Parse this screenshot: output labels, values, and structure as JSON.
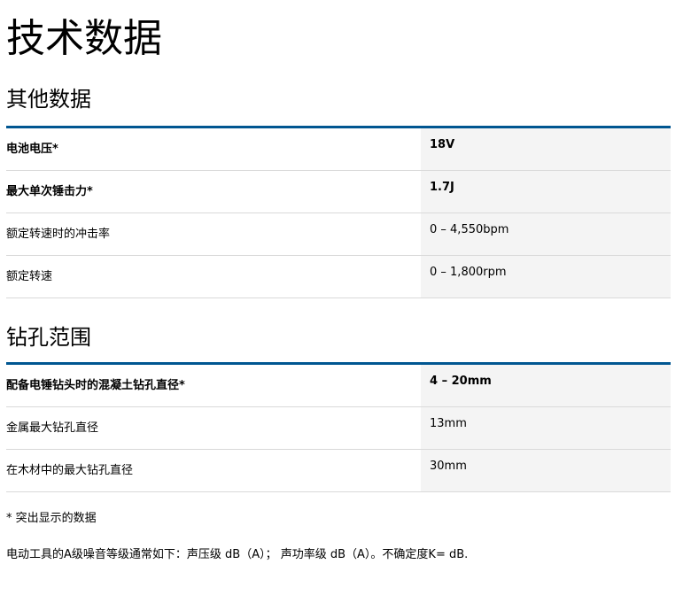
{
  "page_title": "技术数据",
  "sections": [
    {
      "title": "其他数据",
      "rows": [
        {
          "label": "电池电压*",
          "value": "18V",
          "highlight": true
        },
        {
          "label": "最大单次锤击力*",
          "value": "1.7J",
          "highlight": true
        },
        {
          "label": "额定转速时的冲击率",
          "value": "0 – 4,550bpm",
          "highlight": false
        },
        {
          "label": "额定转速",
          "value": "0 – 1,800rpm",
          "highlight": false
        }
      ]
    },
    {
      "title": "钻孔范围",
      "rows": [
        {
          "label": "配备电锤钻头时的混凝土钻孔直径*",
          "value": "4 – 20mm",
          "highlight": true
        },
        {
          "label": "金属最大钻孔直径",
          "value": "13mm",
          "highlight": false
        },
        {
          "label": "在木材中的最大钻孔直径",
          "value": "30mm",
          "highlight": false
        }
      ]
    }
  ],
  "footnotes": {
    "highlight_note": "* 突出显示的数据",
    "noise_note": "电动工具的A级噪音等级通常如下：声压级 dB（A）； 声功率级 dB（A）。不确定度K= dB."
  },
  "colors": {
    "accent": "#005691",
    "value_bg": "#f4f4f4",
    "divider": "#d9d9d9"
  }
}
